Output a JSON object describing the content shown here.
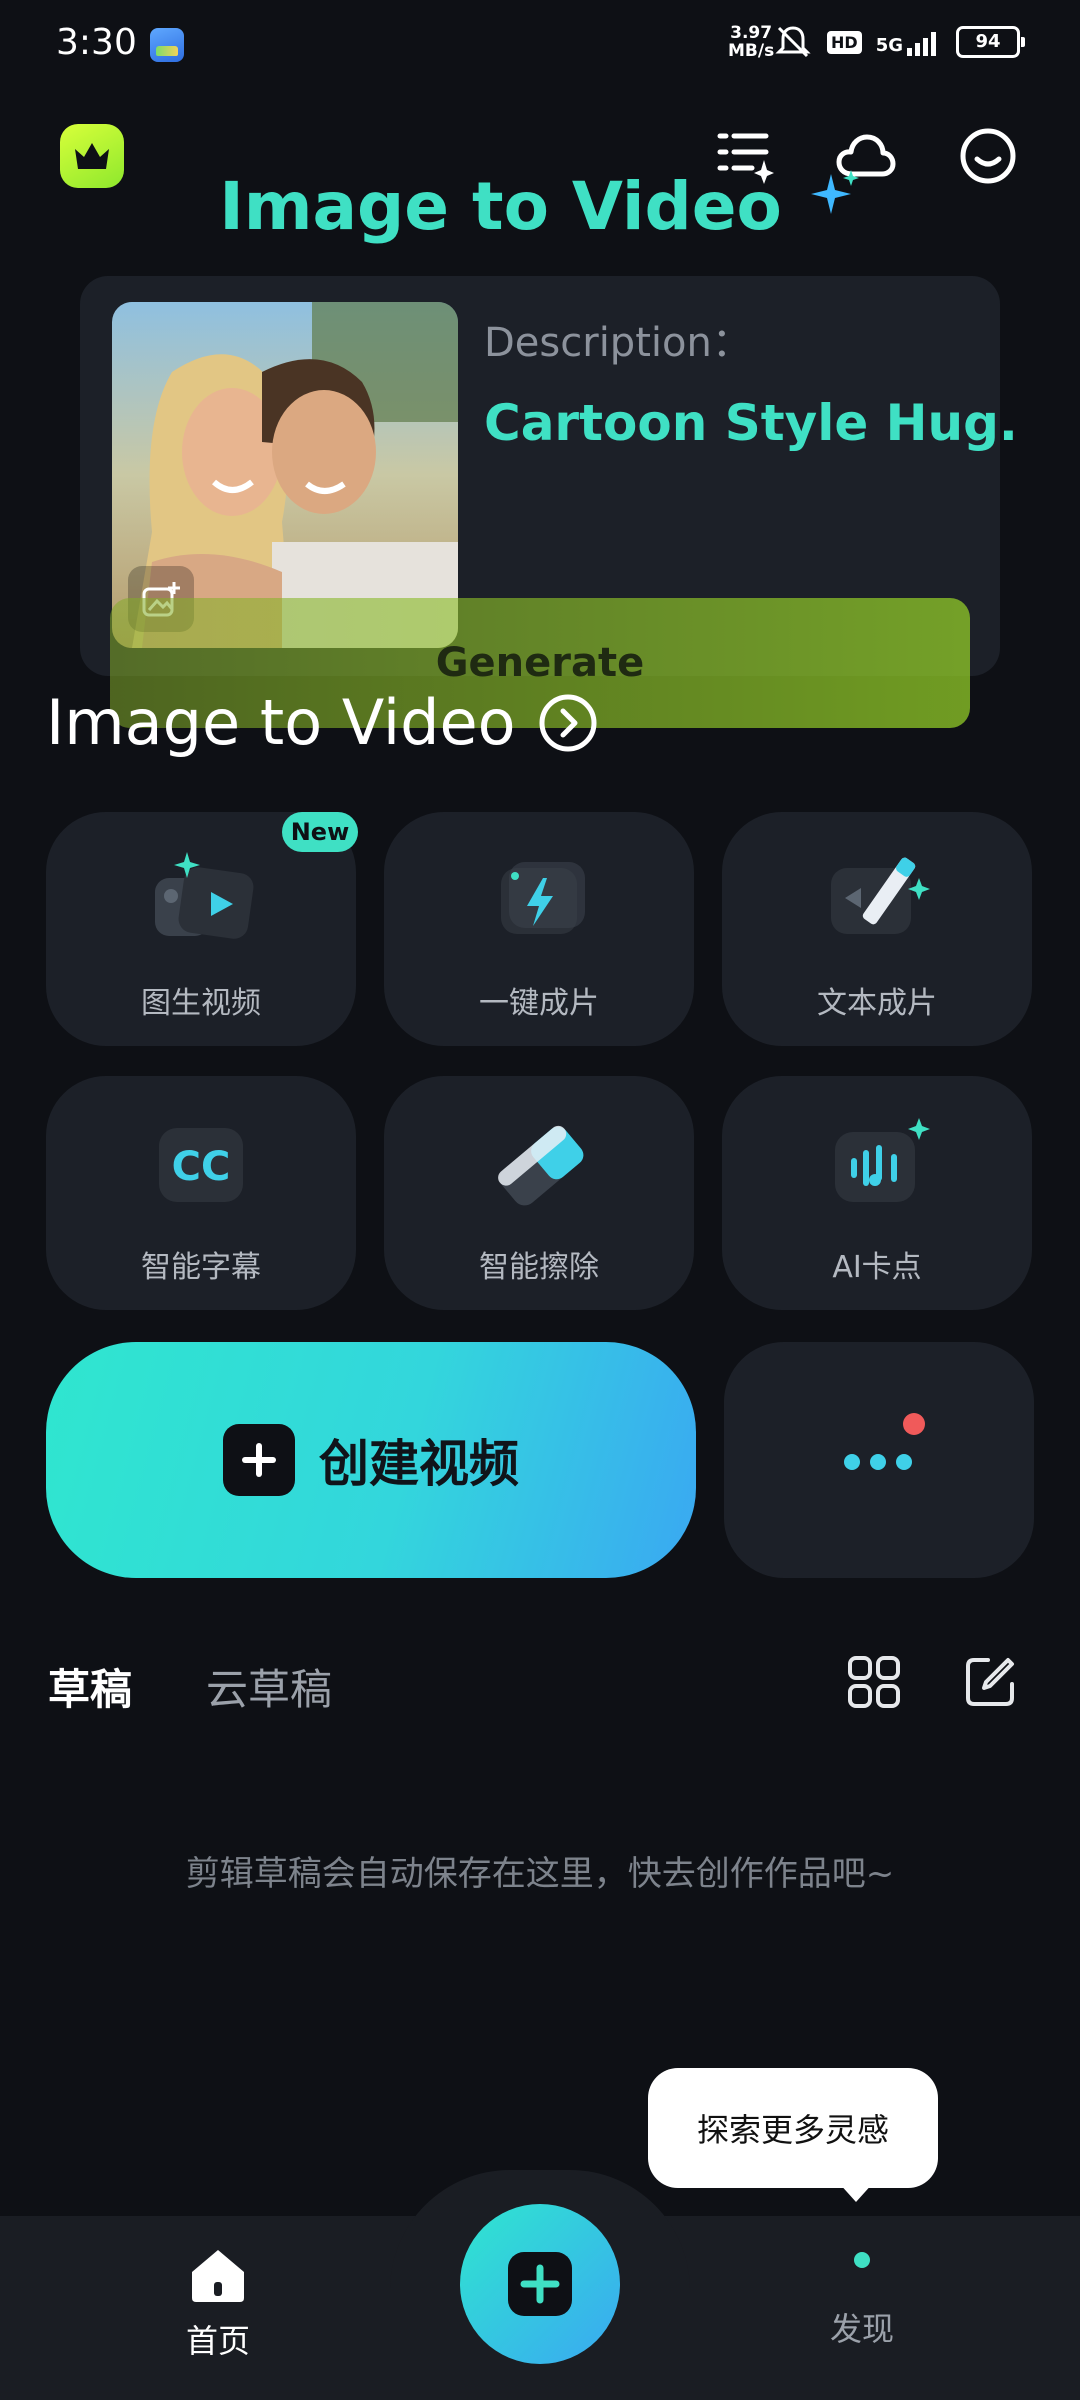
{
  "status_bar": {
    "time": "3:30",
    "speed_value": "3.97",
    "speed_unit": "MB/s",
    "hd": "HD",
    "network": "5G",
    "battery": "94"
  },
  "header": {
    "premium_icon": "crown-icon",
    "list_icon": "list-sparkle-icon",
    "cloud_icon": "cloud-icon",
    "profile_icon": "smile-icon"
  },
  "banner": {
    "title": "Image to Video",
    "description_label": "Description：",
    "description_text": "Cartoon Style Hug.",
    "generate_label": "Generate",
    "accent_color": "#3fe0c4"
  },
  "section": {
    "title": "Image to Video"
  },
  "tools": [
    {
      "label": "图生视频",
      "icon": "image-to-video-icon",
      "badge": "New"
    },
    {
      "label": "一键成片",
      "icon": "lightning-icon"
    },
    {
      "label": "文本成片",
      "icon": "text-to-video-icon"
    },
    {
      "label": "智能字幕",
      "icon": "cc-icon"
    },
    {
      "label": "智能擦除",
      "icon": "eraser-icon"
    },
    {
      "label": "AI卡点",
      "icon": "music-beat-icon"
    }
  ],
  "create": {
    "label": "创建视频"
  },
  "drafts": {
    "tab_local": "草稿",
    "tab_cloud": "云草稿",
    "empty_message": "剪辑草稿会自动保存在这里，快去创作作品吧~"
  },
  "tooltip": {
    "text": "探索更多灵感"
  },
  "nav": {
    "home": "首页",
    "discover": "发现"
  }
}
